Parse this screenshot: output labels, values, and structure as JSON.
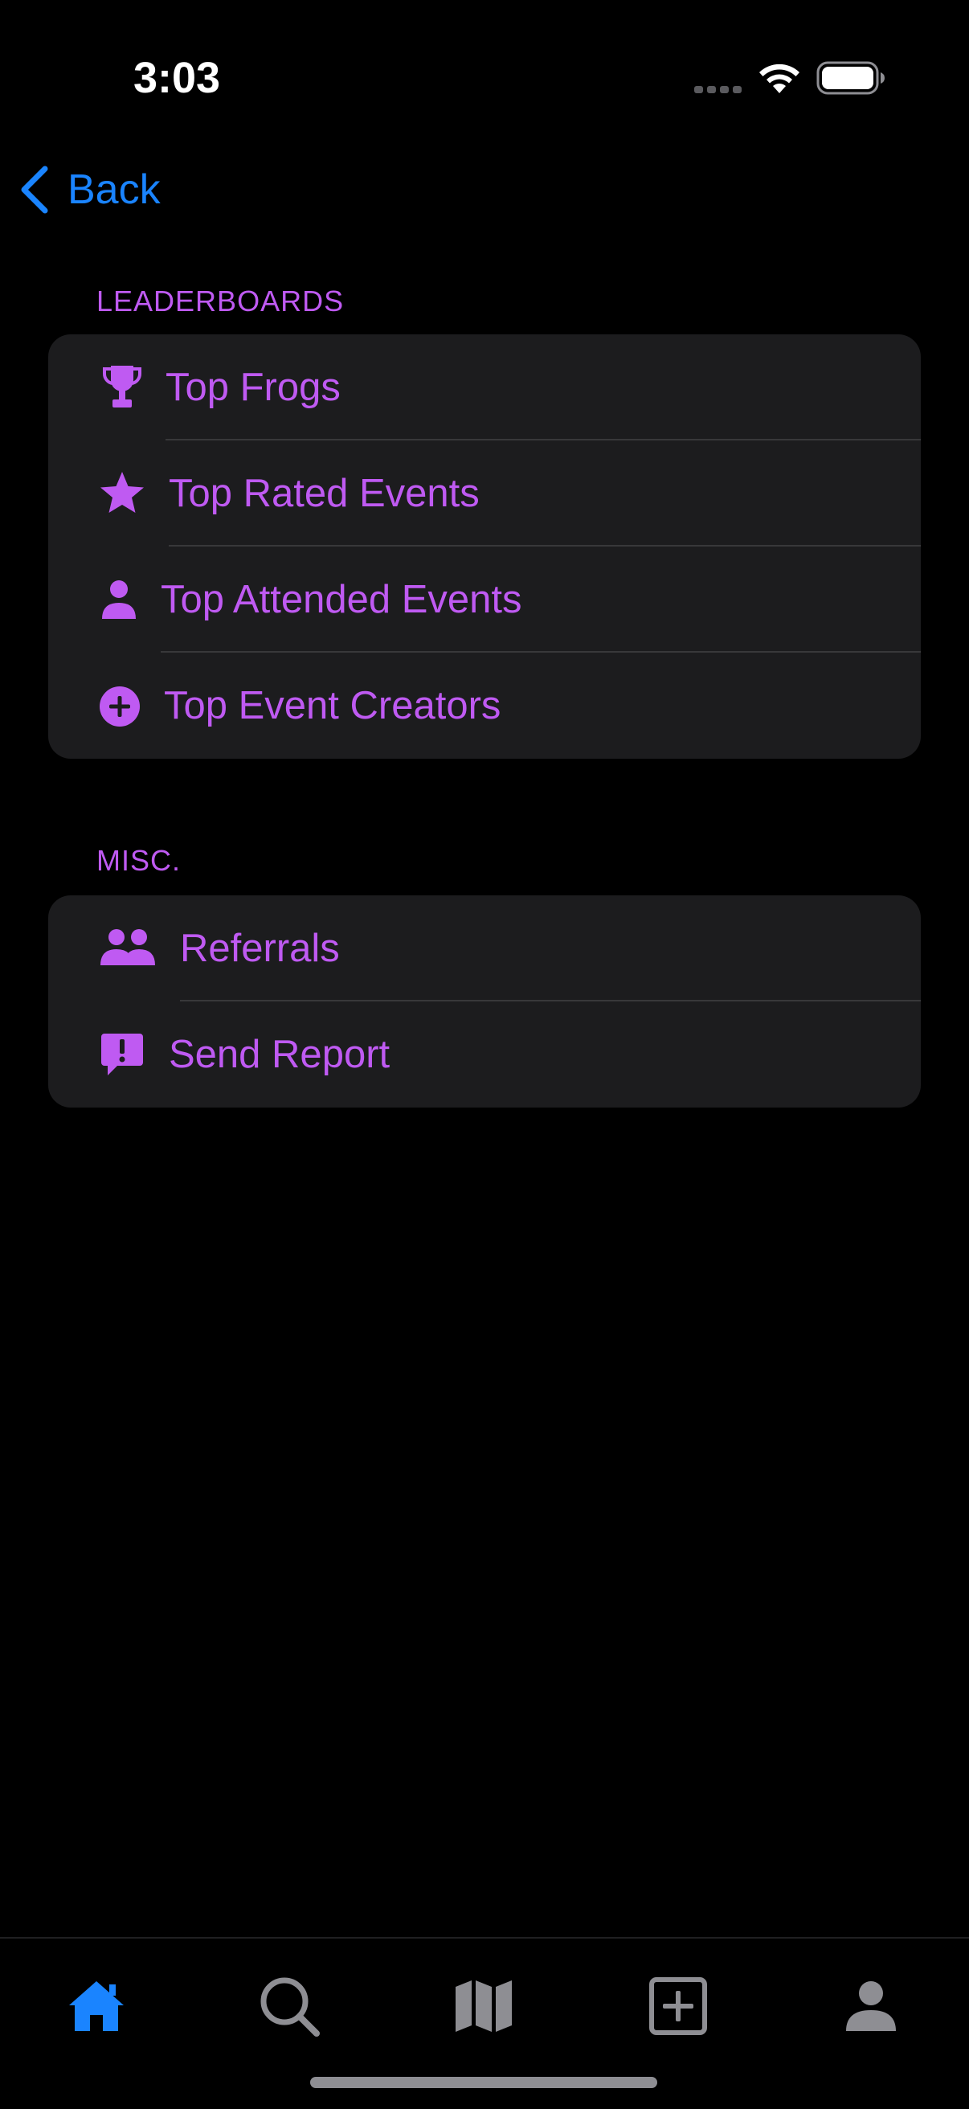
{
  "status_bar": {
    "time": "3:03"
  },
  "nav": {
    "back_label": "Back"
  },
  "sections": [
    {
      "header": "LEADERBOARDS",
      "items": [
        {
          "label": "Top Frogs",
          "icon": "trophy-icon"
        },
        {
          "label": "Top Rated Events",
          "icon": "star-icon"
        },
        {
          "label": "Top Attended Events",
          "icon": "person-icon"
        },
        {
          "label": "Top Event Creators",
          "icon": "plus-circle-icon"
        }
      ]
    },
    {
      "header": "MISC.",
      "items": [
        {
          "label": "Referrals",
          "icon": "people-icon"
        },
        {
          "label": "Send Report",
          "icon": "report-bubble-icon"
        }
      ]
    }
  ],
  "tab_bar": {
    "tabs": [
      {
        "icon": "home-icon",
        "selected": true
      },
      {
        "icon": "search-icon",
        "selected": false
      },
      {
        "icon": "map-icon",
        "selected": false
      },
      {
        "icon": "add-square-icon",
        "selected": false
      },
      {
        "icon": "profile-icon",
        "selected": false
      }
    ]
  },
  "colors": {
    "accent": "#bf5af2",
    "link": "#1a84ff",
    "background": "#000000",
    "group_background": "#1c1c1e",
    "tab_inactive": "#8e8e93",
    "tab_active": "#1a84ff"
  }
}
